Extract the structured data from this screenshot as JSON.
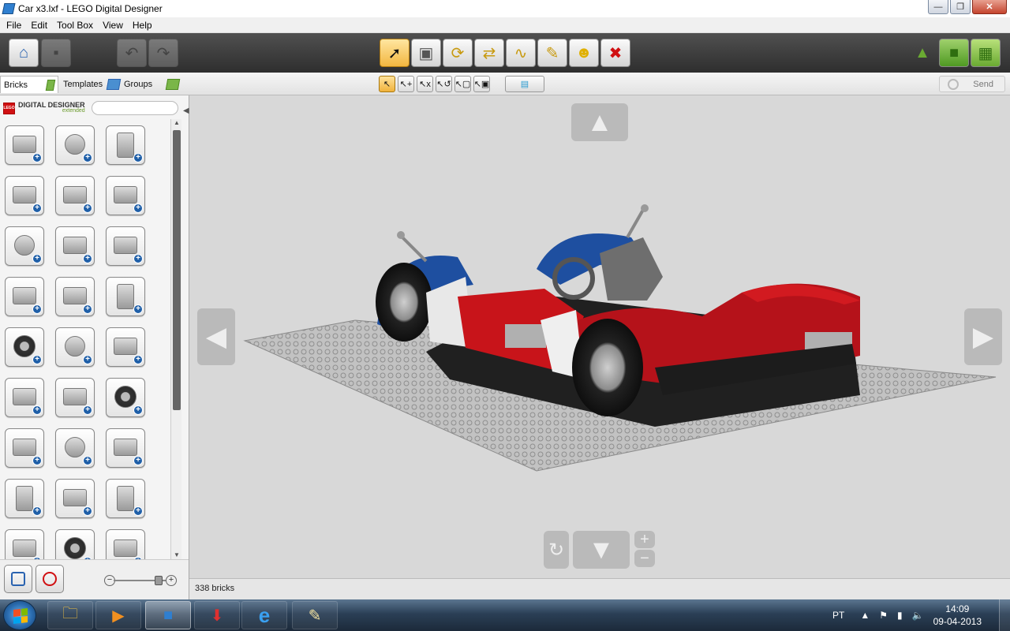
{
  "window": {
    "title": "Car x3.lxf - LEGO Digital Designer",
    "controls": [
      "—",
      "❐",
      "✕"
    ]
  },
  "menu": [
    "File",
    "Edit",
    "Tool Box",
    "View",
    "Help"
  ],
  "toolbar": {
    "tools": [
      {
        "icon": "home-icon",
        "glyph": "⌂",
        "state": "normal"
      },
      {
        "icon": "save-icon",
        "glyph": "▪",
        "state": "disabled"
      },
      {
        "icon": "undo-icon",
        "glyph": "↶",
        "state": "disabled"
      },
      {
        "icon": "redo-icon",
        "glyph": "↷",
        "state": "disabled"
      },
      {
        "icon": "select-icon",
        "glyph": "➚",
        "state": "active"
      },
      {
        "icon": "clone-icon",
        "glyph": "▣",
        "state": "normal"
      },
      {
        "icon": "hinge-icon",
        "glyph": "⟳",
        "state": "normal"
      },
      {
        "icon": "hinge-align-icon",
        "glyph": "⇄",
        "state": "normal"
      },
      {
        "icon": "flex-icon",
        "glyph": "∿",
        "state": "normal"
      },
      {
        "icon": "paint-icon",
        "glyph": "✎",
        "state": "normal"
      },
      {
        "icon": "hide-icon",
        "glyph": "☻",
        "state": "normal"
      },
      {
        "icon": "delete-icon",
        "glyph": "✖",
        "state": "normal"
      }
    ],
    "modes": [
      {
        "icon": "build-mode-icon",
        "glyph": "▲"
      },
      {
        "icon": "view-mode-icon",
        "glyph": "■"
      },
      {
        "icon": "building-guide-icon",
        "glyph": "▦"
      }
    ]
  },
  "panel_tabs": [
    {
      "label": "Bricks",
      "active": true
    },
    {
      "label": "Templates",
      "active": false
    },
    {
      "label": "Groups",
      "active": false
    }
  ],
  "sub_tools": [
    "↖",
    "↖+",
    "↖x",
    "↖↺",
    "↖▢",
    "↖▣",
    "▤"
  ],
  "send": {
    "label": "Send"
  },
  "brand": {
    "logo": "LEGO",
    "name": "DIGITAL DESIGNER",
    "edition": "extended"
  },
  "search": {
    "placeholder": "",
    "value": ""
  },
  "bricks": [
    {
      "name": "brick-2x3",
      "shape": "box"
    },
    {
      "name": "brick-round-corner",
      "shape": "round"
    },
    {
      "name": "brick-technic-pin",
      "shape": "tall"
    },
    {
      "name": "brick-1x4",
      "shape": "box"
    },
    {
      "name": "brick-slope",
      "shape": "box"
    },
    {
      "name": "brick-slope-long",
      "shape": "box"
    },
    {
      "name": "brick-curved",
      "shape": "round"
    },
    {
      "name": "plate-2x2",
      "shape": "box"
    },
    {
      "name": "plate-wedge",
      "shape": "box"
    },
    {
      "name": "plate-special",
      "shape": "box"
    },
    {
      "name": "plate-curved",
      "shape": "box"
    },
    {
      "name": "door-panel",
      "shape": "tall"
    },
    {
      "name": "wheel-tire",
      "shape": "wheel"
    },
    {
      "name": "rim",
      "shape": "round"
    },
    {
      "name": "technic-beam-3",
      "shape": "box"
    },
    {
      "name": "technic-beam-5",
      "shape": "box"
    },
    {
      "name": "technic-axle",
      "shape": "box"
    },
    {
      "name": "gear",
      "shape": "wheel"
    },
    {
      "name": "curved-panel",
      "shape": "box"
    },
    {
      "name": "cylinder",
      "shape": "round"
    },
    {
      "name": "tile-slope",
      "shape": "box"
    },
    {
      "name": "tool-wrench",
      "shape": "tall"
    },
    {
      "name": "angled-plate",
      "shape": "box"
    },
    {
      "name": "frame",
      "shape": "tall"
    },
    {
      "name": "bracket",
      "shape": "box"
    },
    {
      "name": "ship-wheel",
      "shape": "wheel"
    },
    {
      "name": "rail",
      "shape": "box"
    }
  ],
  "status": {
    "bricks_count": "338 bricks"
  },
  "viewport": {
    "arrows": {
      "up": "▲",
      "down": "▼",
      "left": "◀",
      "right": "▶"
    },
    "rotate": "↻",
    "zoom_in": "+",
    "zoom_out": "−"
  },
  "zoom": {
    "out": "−",
    "in": "+",
    "level": 0.9
  },
  "taskbar": {
    "apps": [
      {
        "name": "explorer",
        "glyph": "🗀",
        "active": false
      },
      {
        "name": "media-player",
        "glyph": "▶",
        "active": false
      },
      {
        "name": "lego-digital-designer",
        "glyph": "■",
        "active": true
      },
      {
        "name": "downloader",
        "glyph": "⬇",
        "active": false
      },
      {
        "name": "internet-explorer",
        "glyph": "e",
        "active": false
      },
      {
        "name": "paint",
        "glyph": "✎",
        "active": false
      }
    ],
    "language": "PT",
    "time": "14:09",
    "date": "09-04-2013"
  },
  "colors": {
    "car_red": "#c8141a",
    "car_blue": "#1e4fa0",
    "car_black": "#1c1c1c",
    "baseplate": "#c0c0c0",
    "accent": "#f2b640"
  }
}
